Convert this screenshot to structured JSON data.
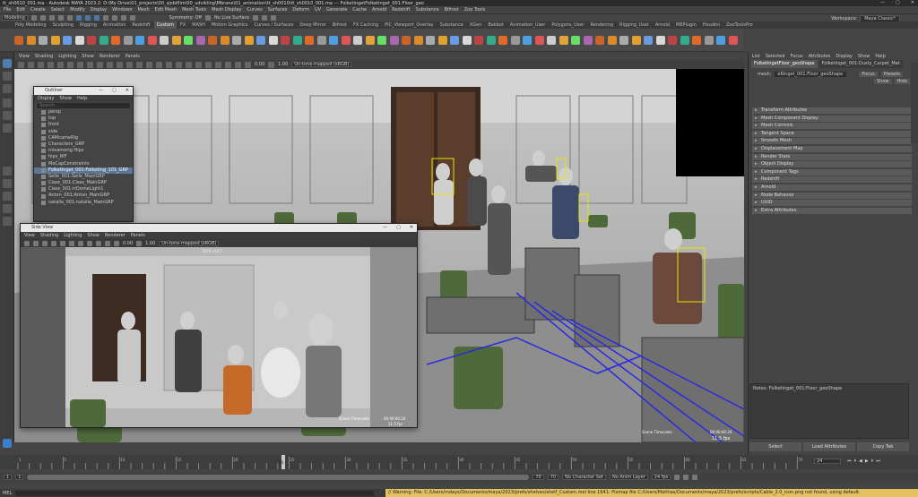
{
  "window": {
    "title": "tt_sh0010_001.ma - Autodesk MAYA 2023.2: D:\\My Drive\\01_projects\\00_sjobiflim\\00_udvikling\\Mbrane\\01_animation\\tt_sh0010\\tt_sh0010_001.ma --- FolketingetFolketinget_001:Floor_geo",
    "min": "—",
    "max": "▢",
    "close": "✕"
  },
  "menus": [
    "File",
    "Edit",
    "Create",
    "Select",
    "Modify",
    "Display",
    "Windows",
    "Mesh",
    "Edit Mesh",
    "Mesh Tools",
    "Mesh Display",
    "Curves",
    "Surfaces",
    "Deform",
    "UV",
    "Generate",
    "Cache",
    "Arnold",
    "Redshift",
    "Substance",
    "Bifrost",
    "Zoo Tools"
  ],
  "workspace": {
    "label": "Workspace:",
    "value": "Maya Classic*"
  },
  "statusline": {
    "mode": "Modeling",
    "symmetry": "Symmetry: Off",
    "no_live": "No Live Surface"
  },
  "shelf_tabs": [
    "Poly Modeling",
    "Sculpting",
    "Rigging",
    "Animation",
    "Redshift",
    "Custom",
    "FX",
    "MASH",
    "Motion Graphics",
    "Curves / Surfaces",
    "Deep Mirror",
    "Bifrost",
    "FX Caching",
    "PIC_Viewport_Overlay",
    "Substance",
    "XGen",
    "Bakbot",
    "Animation_User",
    "Polygons_User",
    "Rendering",
    "Rigging_User",
    "Arnold",
    "MEPlugin",
    "Houdini",
    "ZooToolsPro"
  ],
  "shelf_active": "Custom",
  "viewport": {
    "menus": [
      "View",
      "Shading",
      "Lighting",
      "Show",
      "Renderer",
      "Panels"
    ],
    "exposure": "0.00",
    "gamma": "1.00",
    "colorspace": "Un-tone-mapped (sRGB)",
    "scene_timecode_label": "Scene Timecode:",
    "scene_timecode": "00:00:00:24",
    "fps": "11.5 fps"
  },
  "outliner": {
    "title": "Outliner",
    "menus": [
      "Display",
      "Show",
      "Help"
    ],
    "search_placeholder": "Search...",
    "items": [
      "persp",
      "top",
      "front",
      "side",
      "CAMcameRig",
      "Characters_GRP",
      "mixamorig:Hips",
      "hips_IKF",
      "MoCapConstraints",
      "Folketinget_001:Folketing_101_GRP",
      "Selle_001:Selle_MainGRP",
      "Class_001:Class_MainGRP",
      "Class_001:rrDomeLight1",
      "Anton_001:Anton_MainGRP",
      "natalie_001:natalie_MainGRP"
    ],
    "selected_index": 9
  },
  "sideview": {
    "title": "Side View",
    "menus": [
      "View",
      "Shading",
      "Lighting",
      "Show",
      "Renderer",
      "Panels"
    ],
    "exposure": "0.00",
    "gamma": "1.00",
    "colorspace": "Un-tone-mapped (sRGB)",
    "resolution": "1920 x 817",
    "timecode_label": "Scene Timecode:",
    "timecode": "00:00:00:24",
    "fps": "11.5 fps"
  },
  "attribute_editor": {
    "menus": [
      "List",
      "Selected",
      "Focus",
      "Attributes",
      "Display",
      "Show",
      "Help"
    ],
    "tabs": [
      "FolketingetFloor_geoShape",
      "Folketinget_001:Dusty_Carpet_Mat"
    ],
    "mesh_label": "mesh:",
    "mesh_value": "eKinget_001:Floor_geoShape",
    "focus": "Focus",
    "presets": "Presets",
    "show": "Show",
    "hide": "Hide",
    "sections": [
      "Transform Attributes",
      "Mesh Component Display",
      "Mesh Controls",
      "Tangent Space",
      "Smooth Mesh",
      "Displacement Map",
      "Render Stats",
      "Object Display",
      "Component Tags",
      "Redshift",
      "Arnold",
      "Node Behavior",
      "UUID",
      "Extra Attributes"
    ],
    "notes_label": "Notes: Folketinget_001:Floor_geoShape",
    "buttons": [
      "Select",
      "Load Attributes",
      "Copy Tab"
    ]
  },
  "timeline": {
    "current_frame": "24",
    "ticks": [
      "1",
      "5",
      "10",
      "15",
      "20",
      "25",
      "30",
      "35",
      "40",
      "45",
      "50",
      "55",
      "60",
      "65",
      "70"
    ],
    "frame_field": "24"
  },
  "range": {
    "start": "1",
    "start2": "1",
    "end": "70",
    "end2": "70",
    "char_set": "No Character Set",
    "anim_layer": "No Anim Layer",
    "fps": "24 fps"
  },
  "command": {
    "lang": "MEL",
    "warning": "// Warning: File: C:/Users/mdays/Documents/maya/2023/prefs/shelves/shelf_Custom.mel line 1641: Pixmap file C:/Users/Mathias/Documents/maya/2023/prefs/scripts/Cable_2.0_icon.png not found, using default."
  }
}
